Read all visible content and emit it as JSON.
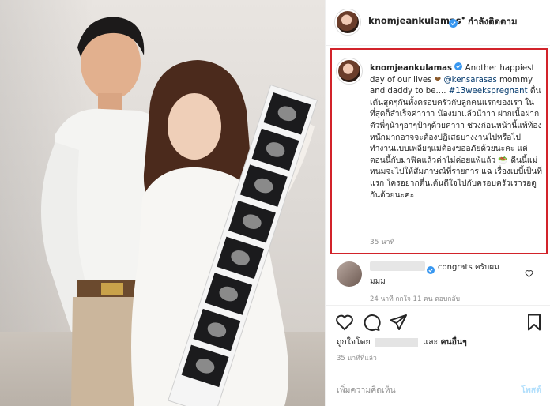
{
  "post": {
    "username": "knomjeankulamas",
    "follow_status": "กำลังติดตาม",
    "separator": "•"
  },
  "caption": {
    "username": "knomjeankulamas",
    "lead": "Another happiest day of our lives",
    "heart": "❤",
    "mention": "@kensarasas",
    "after_mention": "mommy and daddy to be....",
    "hashtag": "#13weekspregnant",
    "body": "ตื่นเต้นสุดๆกันทั้งครอบครัวกับลูกคนแรกของเรา ในที่สุดก็สำเร็จค่าาาา น้องมาแล้วน้าาา ฝากเนื้อฝากตัวพี่ๆน้าๆอาๆป้าๆด้วยค่าาา ช่วงก่อนหน้านี้แพ้ท้องหนักมากอาจจะต้องปฏิเสธบางงานไปหรือไปทำงานแบบเพลียๆแม่ต้องขออภัยด้วยนะคะ แต่ตอนนี้กับมาฟิตแล้วค่าไม่ค่อยแพ้แล้ว 🥗 ดีนนี้แม่หนมจะไปให้สัมภาษณ์ที่รายการ แฉ เรื่องเบบี้เป็นที่แรก ใครอยากตื่นเต้นดีใจไปกับครอบครัวเรารอดูกันด้วยนะคะ",
    "time": "35 นาที"
  },
  "comment": {
    "text": "congrats ครับผม",
    "text2": "มมม",
    "meta": "24 นาที   ถูกใจ 11 คน   ตอบกลับ"
  },
  "likes": {
    "prefix": "ถูกใจโดย",
    "and_label": "และ",
    "others": "คนอื่นๆ"
  },
  "post_time": "35 นาทีที่แล้ว",
  "add_comment": {
    "placeholder": "เพิ่มความคิดเห็น",
    "post_label": "โพสต์"
  },
  "colors": {
    "highlight_border": "#d2232a",
    "verified": "#3897f0",
    "link": "#00376b",
    "post_button_disabled": "#b2dffc"
  },
  "icons": [
    "verified-icon",
    "heart-icon",
    "comment-icon",
    "share-icon",
    "bookmark-icon"
  ]
}
